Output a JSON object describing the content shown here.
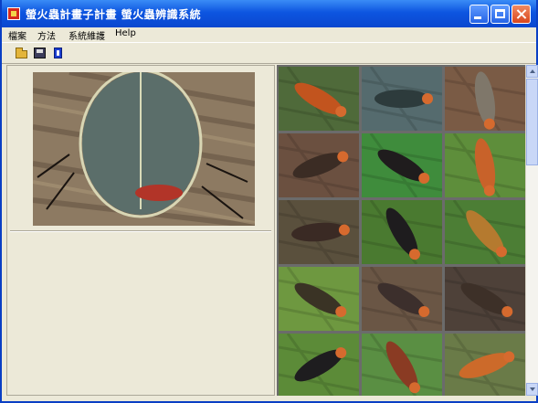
{
  "window": {
    "title": "螢火蟲計畫子計畫  螢火蟲辨識系統",
    "accent": "#0d55e0"
  },
  "menu": {
    "items": [
      {
        "label": "檔案"
      },
      {
        "label": "方法"
      },
      {
        "label": "系統維護"
      },
      {
        "label": "Help"
      }
    ]
  },
  "toolbar": {
    "buttons": [
      {
        "icon": "folder-open-icon"
      },
      {
        "icon": "save-disk-icon"
      },
      {
        "icon": "book-icon"
      }
    ]
  },
  "preview": {
    "subject": "firefly",
    "colors": [
      "#5b6e6a",
      "#b23428",
      "#8d7a62"
    ]
  },
  "gallery": {
    "thumbnails": [
      {
        "bg": "#4f6a3a",
        "body": "#c2541e"
      },
      {
        "bg": "#556b6e",
        "body": "#2d3b3c"
      },
      {
        "bg": "#7a5b45",
        "body": "#7f776a"
      },
      {
        "bg": "#6b5040",
        "body": "#3b2c24"
      },
      {
        "bg": "#3f8c3c",
        "body": "#1f1c1d"
      },
      {
        "bg": "#5e8e3b",
        "body": "#c8622a"
      },
      {
        "bg": "#5a503d",
        "body": "#3a2a24"
      },
      {
        "bg": "#4a7a30",
        "body": "#1e1c1e"
      },
      {
        "bg": "#4c7e35",
        "body": "#b57a2f"
      },
      {
        "bg": "#6e9840",
        "body": "#3a3325"
      },
      {
        "bg": "#6a5645",
        "body": "#3c2f2c"
      },
      {
        "bg": "#4e4139",
        "body": "#3d3028"
      },
      {
        "bg": "#5c8b38",
        "body": "#1e1d1f"
      },
      {
        "bg": "#5a8f43",
        "body": "#8a3b23"
      },
      {
        "bg": "#6a7b48",
        "body": "#cc6a2a"
      }
    ]
  }
}
